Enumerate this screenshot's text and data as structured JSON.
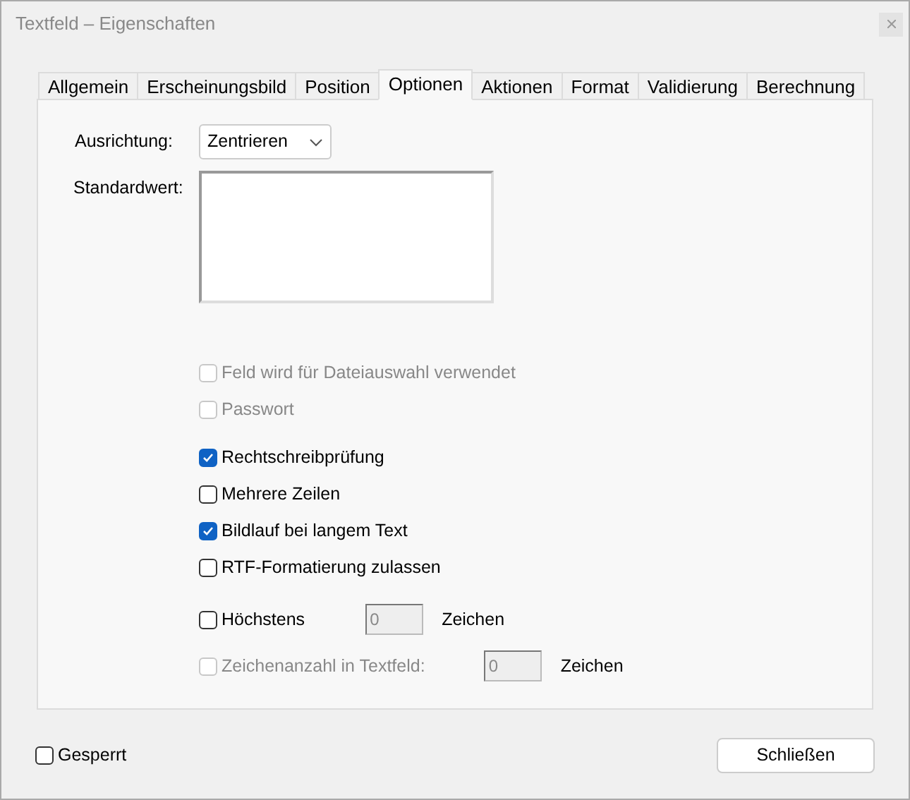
{
  "window": {
    "title": "Textfeld – Eigenschaften"
  },
  "tabs": [
    {
      "label": "Allgemein",
      "selected": false
    },
    {
      "label": "Erscheinungsbild",
      "selected": false
    },
    {
      "label": "Position",
      "selected": false
    },
    {
      "label": "Optionen",
      "selected": true
    },
    {
      "label": "Aktionen",
      "selected": false
    },
    {
      "label": "Format",
      "selected": false
    },
    {
      "label": "Validierung",
      "selected": false
    },
    {
      "label": "Berechnung",
      "selected": false
    }
  ],
  "alignment": {
    "label": "Ausrichtung:",
    "value": "Zentrieren"
  },
  "default_value": {
    "label": "Standardwert:"
  },
  "options": [
    {
      "kind": "check",
      "label": "Feld wird für Dateiauswahl verwendet",
      "checked": false,
      "disabled": true
    },
    {
      "kind": "check",
      "label": "Passwort",
      "checked": false,
      "disabled": true
    },
    {
      "kind": "check",
      "label": "Rechtschreibprüfung",
      "checked": true,
      "disabled": false
    },
    {
      "kind": "check",
      "label": "Mehrere Zeilen",
      "checked": false,
      "disabled": false
    },
    {
      "kind": "check",
      "label": "Bildlauf bei langem Text",
      "checked": true,
      "disabled": false
    },
    {
      "kind": "check",
      "label": "RTF-Formatierung zulassen",
      "checked": false,
      "disabled": false
    },
    {
      "kind": "count",
      "label": "Höchstens",
      "checked": false,
      "disabled": false,
      "value": "0",
      "suffix": "Zeichen"
    },
    {
      "kind": "count",
      "label": "Zeichenanzahl in Textfeld:",
      "checked": false,
      "disabled": true,
      "value": "0",
      "suffix": "Zeichen"
    }
  ],
  "locked": {
    "label": "Gesperrt",
    "checked": false
  },
  "close_button": "Schließen"
}
